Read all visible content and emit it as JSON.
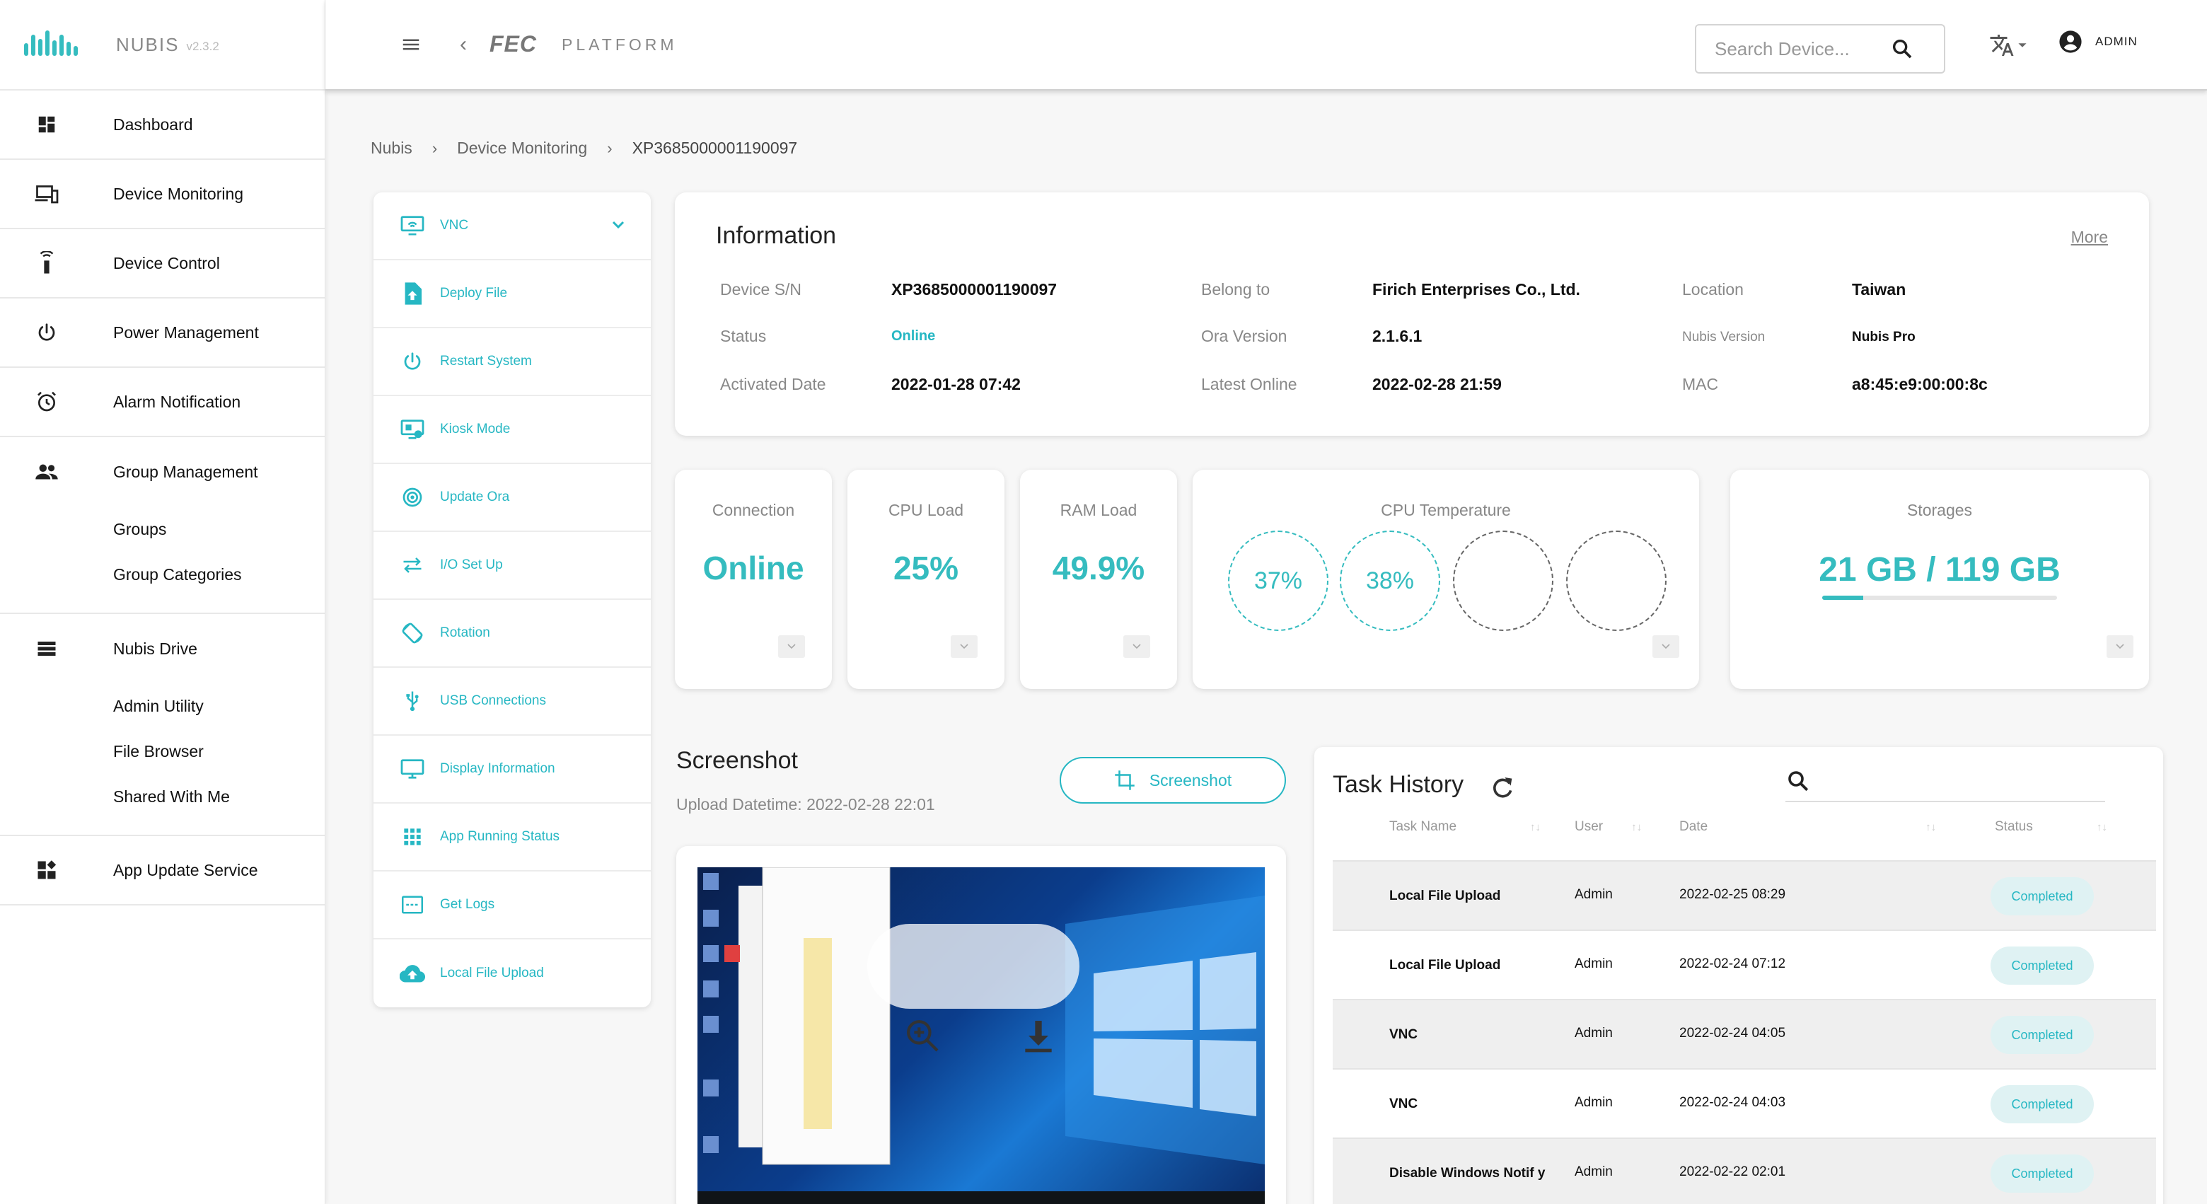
{
  "brand": {
    "name": "NUBIS",
    "version": "v2.3.2"
  },
  "sidebar": {
    "items": [
      {
        "label": "Dashboard",
        "icon": "dashboard-icon"
      },
      {
        "label": "Device Monitoring",
        "icon": "devices-icon"
      },
      {
        "label": "Device Control",
        "icon": "remote-icon"
      },
      {
        "label": "Power Management",
        "icon": "power-icon"
      },
      {
        "label": "Alarm Notification",
        "icon": "alarm-icon"
      },
      {
        "label": "Group Management",
        "icon": "group-icon",
        "children": [
          "Groups",
          "Group Categories"
        ]
      },
      {
        "label": "Nubis Drive",
        "icon": "storage-icon",
        "children": [
          "Admin Utility",
          "File Browser",
          "Shared With Me"
        ]
      },
      {
        "label": "App Update Service",
        "icon": "widgets-icon"
      }
    ]
  },
  "topbar": {
    "logo_fec": "FEC",
    "logo_platform": "PLATFORM",
    "search_placeholder": "Search Device...",
    "user": "ADMIN"
  },
  "breadcrumb": [
    "Nubis",
    "Device Monitoring",
    "XP3685000001190097"
  ],
  "actions": [
    {
      "label": "VNC",
      "icon": "vnc-icon"
    },
    {
      "label": "Deploy File",
      "icon": "deploy-file-icon"
    },
    {
      "label": "Restart System",
      "icon": "restart-icon"
    },
    {
      "label": "Kiosk Mode",
      "icon": "kiosk-icon"
    },
    {
      "label": "Update Ora",
      "icon": "update-icon"
    },
    {
      "label": "I/O Set Up",
      "icon": "io-icon"
    },
    {
      "label": "Rotation",
      "icon": "rotation-icon"
    },
    {
      "label": "USB Connections",
      "icon": "usb-icon"
    },
    {
      "label": "Display Information",
      "icon": "display-icon"
    },
    {
      "label": "App Running Status",
      "icon": "apps-icon"
    },
    {
      "label": "Get Logs",
      "icon": "logs-icon"
    },
    {
      "label": "Local File Upload",
      "icon": "upload-icon"
    }
  ],
  "info": {
    "title": "Information",
    "more": "More",
    "fields": {
      "device_sn": {
        "label": "Device S/N",
        "value": "XP3685000001190097"
      },
      "belong_to": {
        "label": "Belong to",
        "value": "Firich Enterprises Co., Ltd."
      },
      "location": {
        "label": "Location",
        "value": "Taiwan"
      },
      "status": {
        "label": "Status",
        "value": "Online"
      },
      "ora_version": {
        "label": "Ora Version",
        "value": "2.1.6.1"
      },
      "nubis_version": {
        "label": "Nubis Version",
        "value": "Nubis Pro"
      },
      "activated": {
        "label": "Activated Date",
        "value": "2022-01-28 07:42"
      },
      "latest_online": {
        "label": "Latest Online",
        "value": "2022-02-28 21:59"
      },
      "mac": {
        "label": "MAC",
        "value": "a8:45:e9:00:00:8c"
      }
    }
  },
  "stats": {
    "connection": {
      "title": "Connection",
      "value": "Online"
    },
    "cpu": {
      "title": "CPU Load",
      "value": "25%"
    },
    "ram": {
      "title": "RAM Load",
      "value": "49.9%"
    },
    "temperature": {
      "title": "CPU Temperature",
      "values": [
        "37%",
        "38%",
        "",
        ""
      ]
    },
    "storage": {
      "title": "Storages",
      "value": "21 GB / 119 GB",
      "used_fraction": 0.176
    }
  },
  "screenshot": {
    "title": "Screenshot",
    "upload_datetime": "Upload Datetime: 2022-02-28 22:01",
    "button": "Screenshot"
  },
  "task_history": {
    "title": "Task History",
    "columns": [
      "Task Name",
      "User",
      "Date",
      "Status"
    ],
    "rows": [
      {
        "name": "Local File Upload",
        "user": "Admin",
        "date": "2022-02-25 08:29",
        "status": "Completed"
      },
      {
        "name": "Local File Upload",
        "user": "Admin",
        "date": "2022-02-24 07:12",
        "status": "Completed"
      },
      {
        "name": "VNC",
        "user": "Admin",
        "date": "2022-02-24 04:05",
        "status": "Completed"
      },
      {
        "name": "VNC",
        "user": "Admin",
        "date": "2022-02-24 04:03",
        "status": "Completed"
      },
      {
        "name": "Disable Windows Notif y",
        "user": "Admin",
        "date": "2022-02-22 02:01",
        "status": "Completed"
      }
    ]
  },
  "colors": {
    "accent": "#26b7c3",
    "stat": "#35bcbf",
    "badge_bg": "#dff2f3"
  }
}
